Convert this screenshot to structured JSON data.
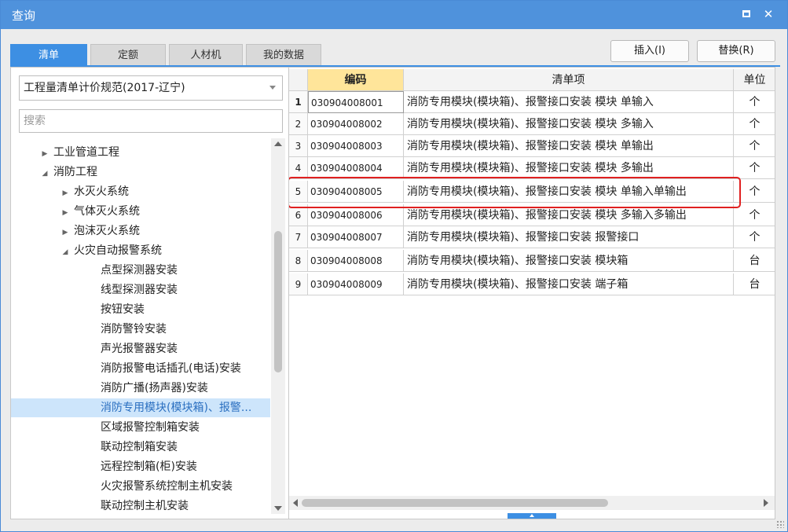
{
  "window": {
    "title": "查询"
  },
  "tabs": [
    {
      "label": "清单",
      "active": true
    },
    {
      "label": "定额",
      "active": false
    },
    {
      "label": "人材机",
      "active": false
    },
    {
      "label": "我的数据",
      "active": false
    }
  ],
  "toolbar": {
    "insert_label": "插入(I)",
    "replace_label": "替换(R)"
  },
  "left": {
    "spec_select": "工程量清单计价规范(2017-辽宁)",
    "search_placeholder": "搜索",
    "tree": [
      {
        "label": "工业管道工程",
        "level": 1,
        "toggle": "collapsed"
      },
      {
        "label": "消防工程",
        "level": 1,
        "toggle": "expanded"
      },
      {
        "label": "水灭火系统",
        "level": 2,
        "toggle": "collapsed"
      },
      {
        "label": "气体灭火系统",
        "level": 2,
        "toggle": "collapsed"
      },
      {
        "label": "泡沫灭火系统",
        "level": 2,
        "toggle": "collapsed"
      },
      {
        "label": "火灾自动报警系统",
        "level": 2,
        "toggle": "expanded"
      },
      {
        "label": "点型探测器安装",
        "level": 3
      },
      {
        "label": "线型探测器安装",
        "level": 3
      },
      {
        "label": "按钮安装",
        "level": 3
      },
      {
        "label": "消防警铃安装",
        "level": 3
      },
      {
        "label": "声光报警器安装",
        "level": 3
      },
      {
        "label": "消防报警电话插孔(电话)安装",
        "level": 3
      },
      {
        "label": "消防广播(扬声器)安装",
        "level": 3
      },
      {
        "label": "消防专用模块(模块箱)、报警...",
        "level": 3,
        "selected": true
      },
      {
        "label": "区域报警控制箱安装",
        "level": 3
      },
      {
        "label": "联动控制箱安装",
        "level": 3
      },
      {
        "label": "远程控制箱(柜)安装",
        "level": 3
      },
      {
        "label": "火灾报警系统控制主机安装",
        "level": 3
      },
      {
        "label": "联动控制主机安装",
        "level": 3
      }
    ]
  },
  "grid": {
    "headers": {
      "code": "编码",
      "item": "清单项",
      "unit": "单位"
    },
    "rows": [
      {
        "no": "1",
        "code": "030904008001",
        "item": "消防专用模块(模块箱)、报警接口安装 模块 单输入",
        "unit": "个"
      },
      {
        "no": "2",
        "code": "030904008002",
        "item": "消防专用模块(模块箱)、报警接口安装 模块 多输入",
        "unit": "个"
      },
      {
        "no": "3",
        "code": "030904008003",
        "item": "消防专用模块(模块箱)、报警接口安装 模块 单输出",
        "unit": "个"
      },
      {
        "no": "4",
        "code": "030904008004",
        "item": "消防专用模块(模块箱)、报警接口安装 模块 多输出",
        "unit": "个"
      },
      {
        "no": "5",
        "code": "030904008005",
        "item": "消防专用模块(模块箱)、报警接口安装 模块 单输入单输出",
        "unit": "个"
      },
      {
        "no": "6",
        "code": "030904008006",
        "item": "消防专用模块(模块箱)、报警接口安装 模块 多输入多输出",
        "unit": "个"
      },
      {
        "no": "7",
        "code": "030904008007",
        "item": "消防专用模块(模块箱)、报警接口安装 报警接口",
        "unit": "个"
      },
      {
        "no": "8",
        "code": "030904008008",
        "item": "消防专用模块(模块箱)、报警接口安装 模块箱",
        "unit": "台"
      },
      {
        "no": "9",
        "code": "030904008009",
        "item": "消防专用模块(模块箱)、报警接口安装 端子箱",
        "unit": "台"
      }
    ]
  },
  "colors": {
    "accent": "#3d8fe3",
    "titlebar": "#4f92dc",
    "highlight": "#e02020",
    "code_header": "#ffe59a"
  }
}
